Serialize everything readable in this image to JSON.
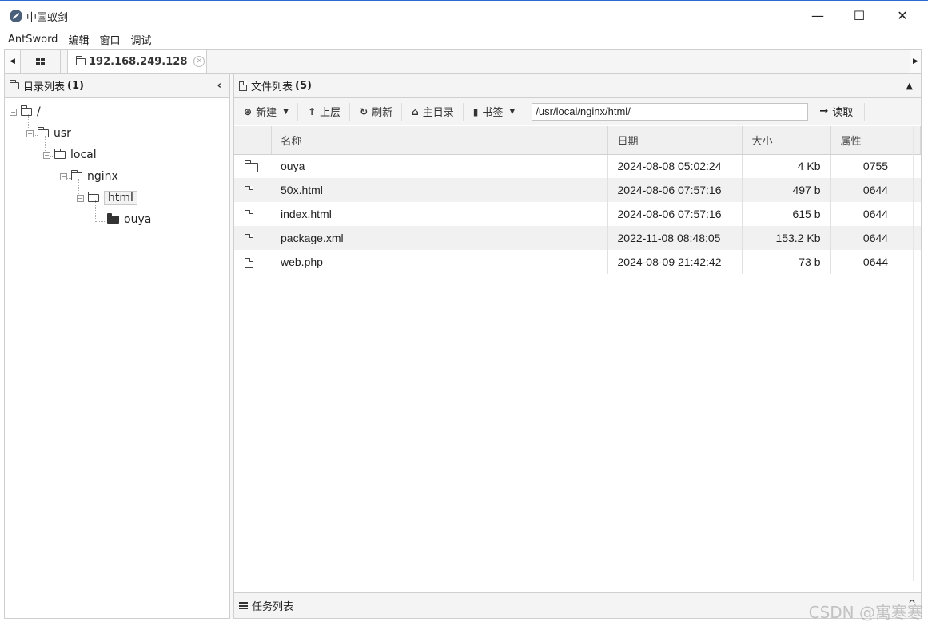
{
  "window": {
    "title": "中国蚁剑",
    "minimize_label": "—",
    "maximize_label": "☐",
    "close_label": "✕"
  },
  "menu": {
    "items": [
      "AntSword",
      "编辑",
      "窗口",
      "调试"
    ]
  },
  "tabs": {
    "active_label": "192.168.249.128"
  },
  "left_panel": {
    "title": "目录列表",
    "count": "(1)",
    "tree": [
      {
        "label": "/",
        "depth": 0,
        "expanded": true
      },
      {
        "label": "usr",
        "depth": 1,
        "expanded": true
      },
      {
        "label": "local",
        "depth": 2,
        "expanded": true
      },
      {
        "label": "nginx",
        "depth": 3,
        "expanded": true
      },
      {
        "label": "html",
        "depth": 4,
        "expanded": true,
        "selected": true
      },
      {
        "label": "ouya",
        "depth": 5,
        "expanded": false
      }
    ]
  },
  "right_panel": {
    "title": "文件列表",
    "count": "(5)",
    "toolbar": {
      "new_label": "新建",
      "up_label": "上层",
      "refresh_label": "刷新",
      "home_label": "主目录",
      "bookmark_label": "书签",
      "path_value": "/usr/local/nginx/html/",
      "read_label": "读取"
    },
    "columns": {
      "name": "名称",
      "date": "日期",
      "size": "大小",
      "attr": "属性"
    },
    "files": [
      {
        "type": "folder",
        "name": "ouya",
        "date": "2024-08-08 05:02:24",
        "size": "4 Kb",
        "attr": "0755"
      },
      {
        "type": "file",
        "name": "50x.html",
        "date": "2024-08-06 07:57:16",
        "size": "497 b",
        "attr": "0644"
      },
      {
        "type": "file",
        "name": "index.html",
        "date": "2024-08-06 07:57:16",
        "size": "615 b",
        "attr": "0644"
      },
      {
        "type": "file",
        "name": "package.xml",
        "date": "2022-11-08 08:48:05",
        "size": "153.2 Kb",
        "attr": "0644"
      },
      {
        "type": "file",
        "name": "web.php",
        "date": "2024-08-09 21:42:42",
        "size": "73 b",
        "attr": "0644"
      }
    ],
    "task_bar_label": "任务列表"
  },
  "watermark": "CSDN @寓寒寒",
  "icons": [
    "app-logo-icon",
    "grid-icon",
    "folder-icon",
    "close-circle-icon",
    "plus-circle-icon",
    "arrow-up-icon",
    "refresh-icon",
    "home-icon",
    "bookmark-icon",
    "arrow-right-icon",
    "file-code-icon",
    "tasks-icon",
    "chevron-left-icon",
    "chevron-up-icon"
  ]
}
